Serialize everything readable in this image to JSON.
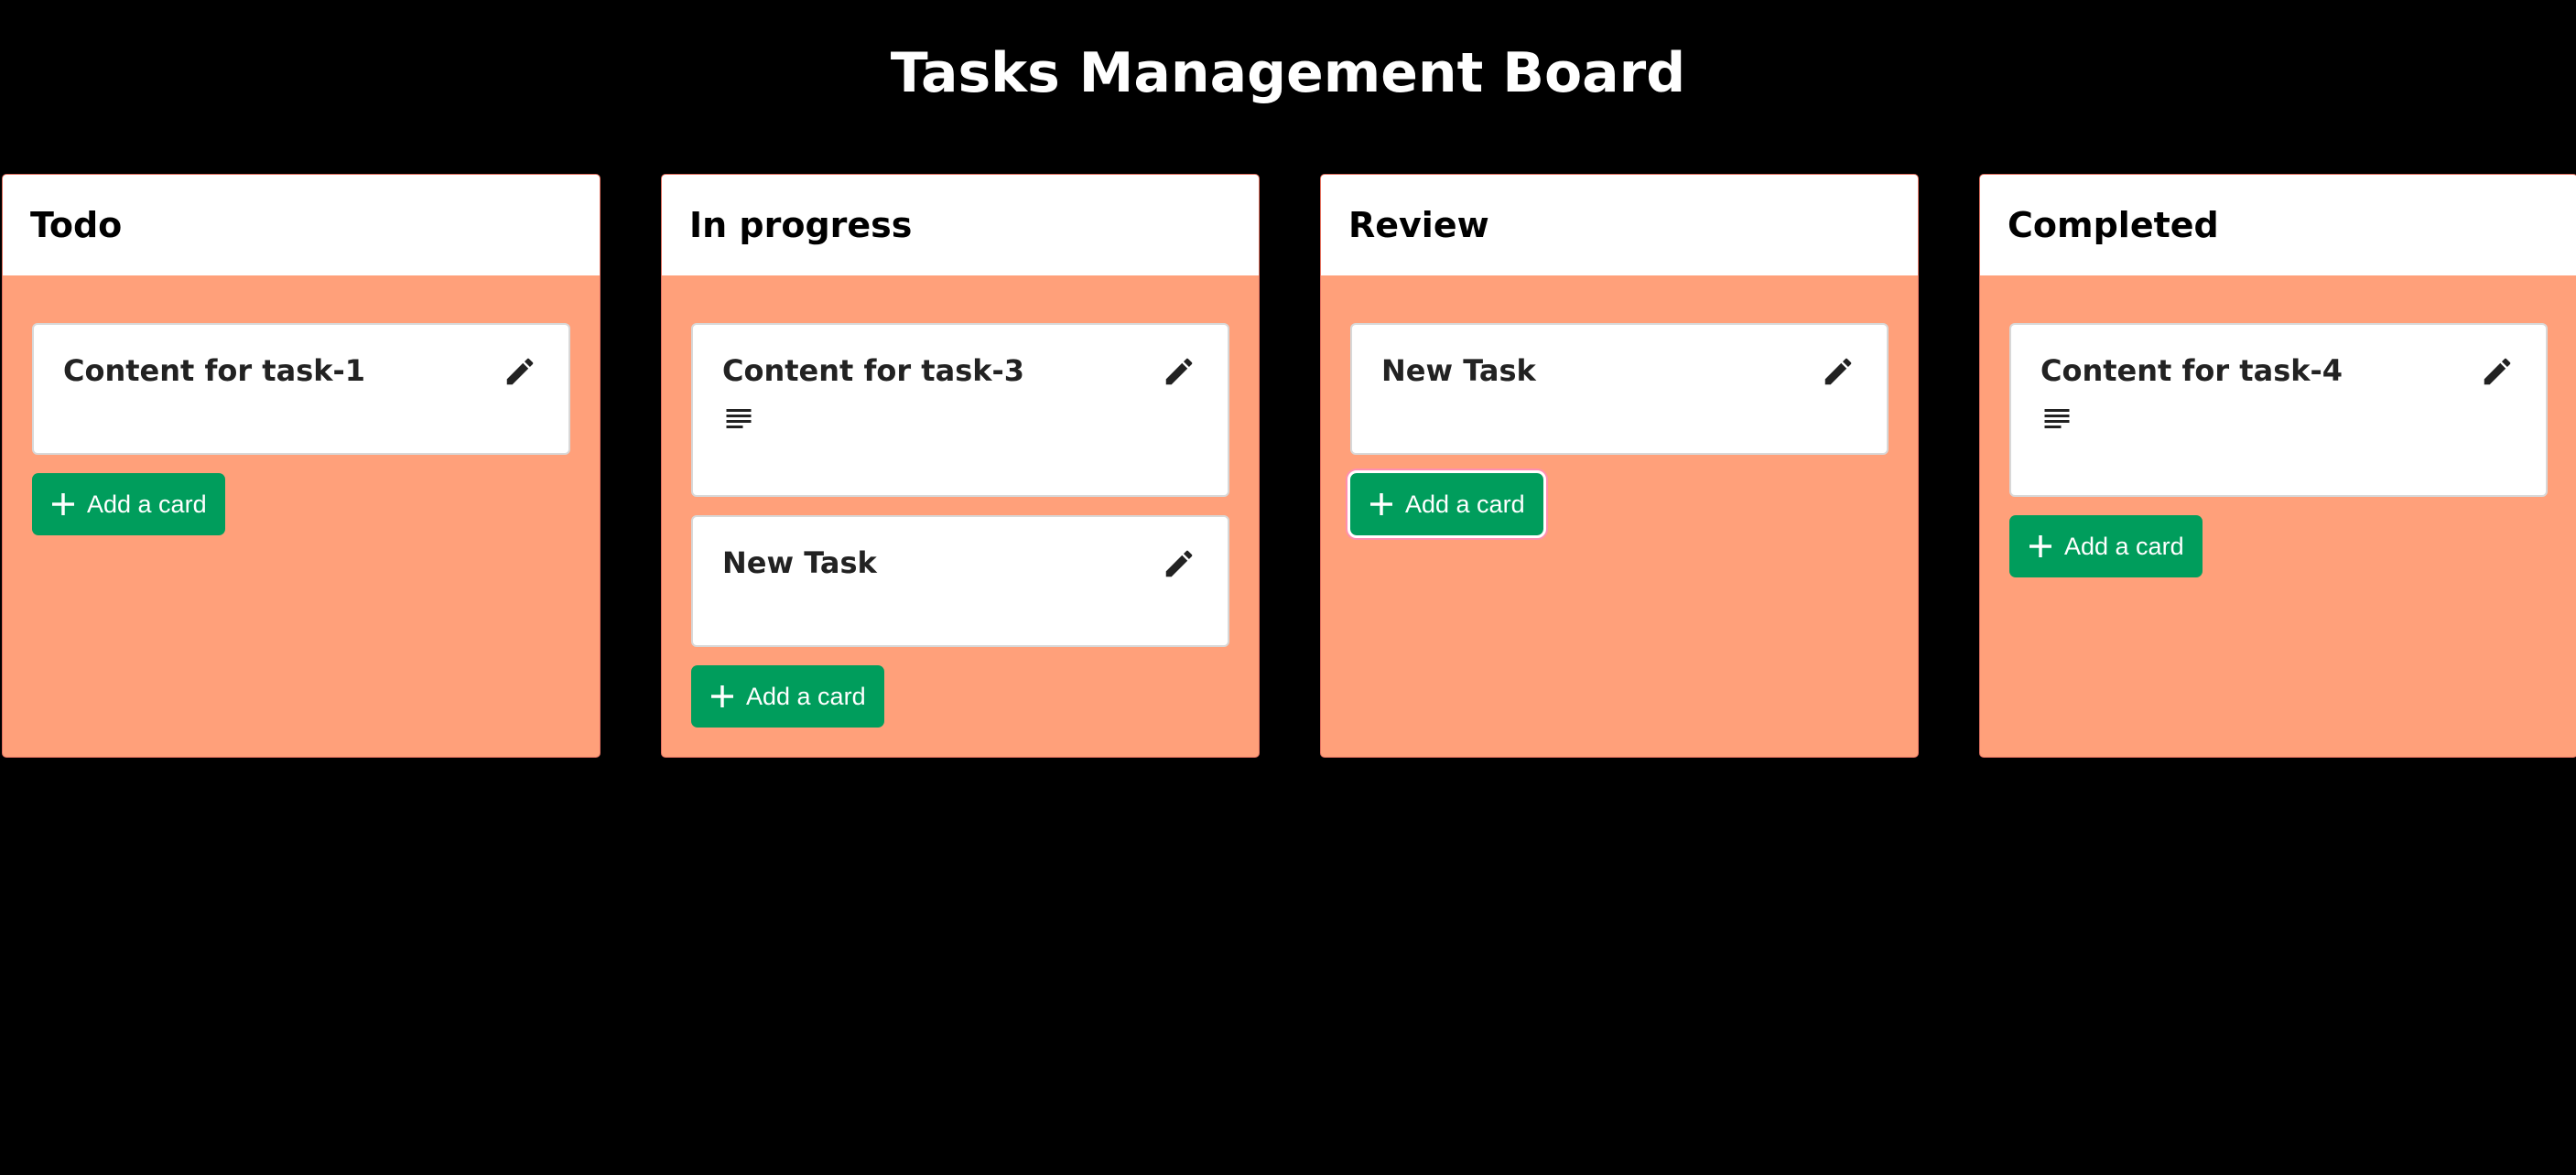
{
  "page": {
    "title": "Tasks Management Board"
  },
  "columns": [
    {
      "title": "Todo",
      "cards": [
        {
          "title": "Content for task-1",
          "has_description": false
        }
      ],
      "add_label": "Add a card"
    },
    {
      "title": "In progress",
      "cards": [
        {
          "title": "Content for task-3",
          "has_description": true
        },
        {
          "title": "New Task",
          "has_description": false
        }
      ],
      "add_label": "Add a card"
    },
    {
      "title": "Review",
      "cards": [
        {
          "title": "New Task",
          "has_description": false
        }
      ],
      "add_label": "Add a card"
    },
    {
      "title": "Completed",
      "cards": [
        {
          "title": "Content for task-4",
          "has_description": true
        }
      ],
      "add_label": "Add a card"
    }
  ],
  "icons": {
    "edit": "pencil-icon",
    "description": "description-lines-icon",
    "add": "plus-icon"
  },
  "colors": {
    "background": "#000000",
    "column_body": "#ffa07a",
    "column_header": "#ffffff",
    "card": "#ffffff",
    "add_button": "#009d5c",
    "title_text": "#ffffff"
  }
}
